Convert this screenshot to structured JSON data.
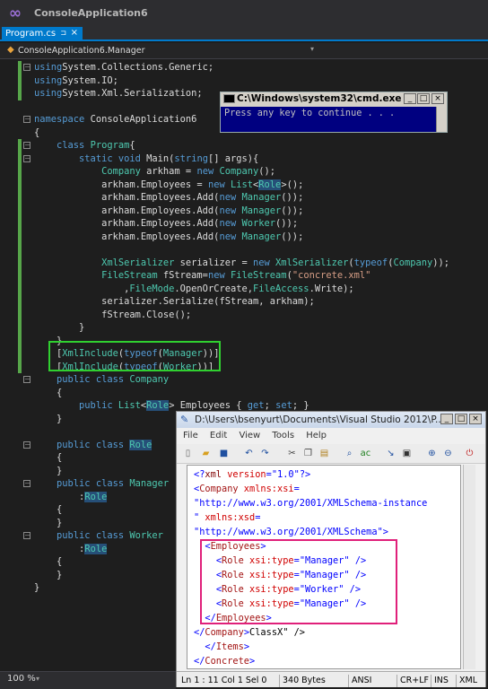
{
  "app": {
    "title": "ConsoleApplication6"
  },
  "tab": {
    "label": "Program.cs",
    "pin": "⊐",
    "close": "×"
  },
  "nav": {
    "label": "ConsoleApplication6.Manager",
    "dropdown": "▾"
  },
  "code": [
    {
      "t": [
        [
          "kw",
          "using"
        ],
        [
          "",
          "System.Collections.Generic;"
        ]
      ]
    },
    {
      "t": [
        [
          "kw",
          "using"
        ],
        [
          "",
          "System.IO;"
        ]
      ]
    },
    {
      "t": [
        [
          "kw",
          "using"
        ],
        [
          "",
          "System.Xml.Serialization;"
        ]
      ]
    },
    {
      "t": []
    },
    {
      "t": [
        [
          "kw",
          "namespace"
        ],
        [
          "",
          " ConsoleApplication6"
        ]
      ]
    },
    {
      "t": [
        [
          "",
          "{"
        ]
      ]
    },
    {
      "t": [
        [
          "",
          "    "
        ],
        [
          "kw",
          "class"
        ],
        [
          "",
          " "
        ],
        [
          "ty",
          "Program"
        ],
        [
          "",
          "{"
        ]
      ]
    },
    {
      "t": [
        [
          "",
          "        "
        ],
        [
          "kw",
          "static void"
        ],
        [
          "",
          " Main("
        ],
        [
          "kw",
          "string"
        ],
        [
          "",
          "[] args){"
        ]
      ]
    },
    {
      "t": [
        [
          "",
          "            "
        ],
        [
          "ty",
          "Company"
        ],
        [
          "",
          " arkham = "
        ],
        [
          "kw",
          "new"
        ],
        [
          "",
          " "
        ],
        [
          "ty",
          "Company"
        ],
        [
          "",
          "();"
        ]
      ]
    },
    {
      "t": [
        [
          "",
          "            arkham.Employees = "
        ],
        [
          "kw",
          "new"
        ],
        [
          "",
          " "
        ],
        [
          "ty",
          "List"
        ],
        [
          "",
          "<"
        ],
        [
          "hl ty",
          "Role"
        ],
        [
          "",
          ">();"
        ]
      ]
    },
    {
      "t": [
        [
          "",
          "            arkham.Employees.Add("
        ],
        [
          "kw",
          "new"
        ],
        [
          "",
          " "
        ],
        [
          "ty",
          "Manager"
        ],
        [
          "",
          "());"
        ]
      ]
    },
    {
      "t": [
        [
          "",
          "            arkham.Employees.Add("
        ],
        [
          "kw",
          "new"
        ],
        [
          "",
          " "
        ],
        [
          "ty",
          "Manager"
        ],
        [
          "",
          "());"
        ]
      ]
    },
    {
      "t": [
        [
          "",
          "            arkham.Employees.Add("
        ],
        [
          "kw",
          "new"
        ],
        [
          "",
          " "
        ],
        [
          "ty",
          "Worker"
        ],
        [
          "",
          "());"
        ]
      ]
    },
    {
      "t": [
        [
          "",
          "            arkham.Employees.Add("
        ],
        [
          "kw",
          "new"
        ],
        [
          "",
          " "
        ],
        [
          "ty",
          "Manager"
        ],
        [
          "",
          "());"
        ]
      ]
    },
    {
      "t": []
    },
    {
      "t": [
        [
          "",
          "            "
        ],
        [
          "ty",
          "XmlSerializer"
        ],
        [
          "",
          " serializer = "
        ],
        [
          "kw",
          "new"
        ],
        [
          "",
          " "
        ],
        [
          "ty",
          "XmlSerializer"
        ],
        [
          "",
          "("
        ],
        [
          "kw",
          "typeof"
        ],
        [
          "",
          "("
        ],
        [
          "ty",
          "Company"
        ],
        [
          "",
          "));"
        ]
      ]
    },
    {
      "t": [
        [
          "",
          "            "
        ],
        [
          "ty",
          "FileStream"
        ],
        [
          "",
          " fStream="
        ],
        [
          "kw",
          "new"
        ],
        [
          "",
          " "
        ],
        [
          "ty",
          "FileStream"
        ],
        [
          "",
          "("
        ],
        [
          "st",
          "\"concrete.xml\""
        ]
      ]
    },
    {
      "t": [
        [
          "",
          "                ,"
        ],
        [
          "ty",
          "FileMode"
        ],
        [
          "",
          ".OpenOrCreate,"
        ],
        [
          "ty",
          "FileAccess"
        ],
        [
          "",
          ".Write);"
        ]
      ]
    },
    {
      "t": [
        [
          "",
          "            serializer.Serialize(fStream, arkham);"
        ]
      ]
    },
    {
      "t": [
        [
          "",
          "            fStream.Close();"
        ]
      ]
    },
    {
      "t": [
        [
          "",
          "        }"
        ]
      ]
    },
    {
      "t": [
        [
          "",
          "    }"
        ]
      ]
    },
    {
      "t": [
        [
          "",
          "    ["
        ],
        [
          "ty",
          "XmlInclude"
        ],
        [
          "",
          "("
        ],
        [
          "kw",
          "typeof"
        ],
        [
          "",
          "("
        ],
        [
          "ty",
          "Manager"
        ],
        [
          "",
          "))]"
        ]
      ]
    },
    {
      "t": [
        [
          "",
          "    ["
        ],
        [
          "ty",
          "XmlInclude"
        ],
        [
          "",
          "("
        ],
        [
          "kw",
          "typeof"
        ],
        [
          "",
          "("
        ],
        [
          "ty",
          "Worker"
        ],
        [
          "",
          "))]"
        ]
      ]
    },
    {
      "t": [
        [
          "",
          "    "
        ],
        [
          "kw",
          "public class"
        ],
        [
          "",
          " "
        ],
        [
          "ty",
          "Company"
        ]
      ]
    },
    {
      "t": [
        [
          "",
          "    {"
        ]
      ]
    },
    {
      "t": [
        [
          "",
          "        "
        ],
        [
          "kw",
          "public"
        ],
        [
          "",
          " "
        ],
        [
          "ty",
          "List"
        ],
        [
          "",
          "<"
        ],
        [
          "hl ty",
          "Role"
        ],
        [
          "",
          "> Employees { "
        ],
        [
          "kw",
          "get"
        ],
        [
          "",
          "; "
        ],
        [
          "kw",
          "set"
        ],
        [
          "",
          "; }"
        ]
      ]
    },
    {
      "t": [
        [
          "",
          "    }"
        ]
      ]
    },
    {
      "t": []
    },
    {
      "t": [
        [
          "",
          "    "
        ],
        [
          "kw",
          "public class"
        ],
        [
          "",
          " "
        ],
        [
          "hl ty",
          "Role"
        ]
      ]
    },
    {
      "t": [
        [
          "",
          "    {"
        ]
      ]
    },
    {
      "t": [
        [
          "",
          "    }"
        ]
      ]
    },
    {
      "t": [
        [
          "",
          "    "
        ],
        [
          "kw",
          "public class"
        ],
        [
          "",
          " "
        ],
        [
          "ty",
          "Manager"
        ]
      ]
    },
    {
      "t": [
        [
          "",
          "        :"
        ],
        [
          "hl ty",
          "Role"
        ]
      ]
    },
    {
      "t": [
        [
          "",
          "    {"
        ]
      ]
    },
    {
      "t": [
        [
          "",
          "    }"
        ]
      ]
    },
    {
      "t": [
        [
          "",
          "    "
        ],
        [
          "kw",
          "public class"
        ],
        [
          "",
          " "
        ],
        [
          "ty",
          "Worker"
        ]
      ]
    },
    {
      "t": [
        [
          "",
          "        :"
        ],
        [
          "hl ty",
          "Role"
        ]
      ]
    },
    {
      "t": [
        [
          "",
          "    {"
        ]
      ]
    },
    {
      "t": [
        [
          "",
          "    }"
        ]
      ]
    },
    {
      "t": [
        [
          "",
          "}"
        ]
      ]
    }
  ],
  "cmd": {
    "title": "C:\\Windows\\system32\\cmd.exe",
    "output": "Press any key to continue . . .",
    "min": "_",
    "max": "□",
    "close": "×"
  },
  "notepad": {
    "title": "D:\\Users\\bsenyurt\\Documents\\Visual Studio 2012\\P...",
    "menu": [
      "File",
      "Edit",
      "View",
      "Tools",
      "Help"
    ],
    "xml": [
      [
        [
          "xb",
          "<?"
        ],
        [
          "xk",
          "xml"
        ],
        [
          "xa",
          " version"
        ],
        [
          "xb",
          "="
        ],
        [
          "xv",
          "\"1.0\""
        ],
        [
          "xb",
          "?>"
        ]
      ],
      [
        [
          "xb",
          "<"
        ],
        [
          "xt",
          "Company"
        ],
        [
          "xa",
          " xmlns:xsi"
        ],
        [
          "xb",
          "="
        ]
      ],
      [
        [
          "xv",
          "\"http://www.w3.org/2001/XMLSchema-instance"
        ]
      ],
      [
        [
          "xv",
          "\""
        ],
        [
          "xa",
          " xmlns:xsd"
        ],
        [
          "xb",
          "="
        ]
      ],
      [
        [
          "xv",
          "\"http://www.w3.org/2001/XMLSchema\""
        ],
        [
          "xb",
          ">"
        ]
      ],
      [
        [
          "",
          "  "
        ],
        [
          "xb",
          "<"
        ],
        [
          "xt",
          "Employees"
        ],
        [
          "xb",
          ">"
        ]
      ],
      [
        [
          "",
          "    "
        ],
        [
          "xb",
          "<"
        ],
        [
          "xt",
          "Role"
        ],
        [
          "xa",
          " xsi:type"
        ],
        [
          "xb",
          "="
        ],
        [
          "xv",
          "\"Manager\""
        ],
        [
          "xb",
          " />"
        ]
      ],
      [
        [
          "",
          "    "
        ],
        [
          "xb",
          "<"
        ],
        [
          "xt",
          "Role"
        ],
        [
          "xa",
          " xsi:type"
        ],
        [
          "xb",
          "="
        ],
        [
          "xv",
          "\"Manager\""
        ],
        [
          "xb",
          " />"
        ]
      ],
      [
        [
          "",
          "    "
        ],
        [
          "xb",
          "<"
        ],
        [
          "xt",
          "Role"
        ],
        [
          "xa",
          " xsi:type"
        ],
        [
          "xb",
          "="
        ],
        [
          "xv",
          "\"Worker\""
        ],
        [
          "xb",
          " />"
        ]
      ],
      [
        [
          "",
          "    "
        ],
        [
          "xb",
          "<"
        ],
        [
          "xt",
          "Role"
        ],
        [
          "xa",
          " xsi:type"
        ],
        [
          "xb",
          "="
        ],
        [
          "xv",
          "\"Manager\""
        ],
        [
          "xb",
          " />"
        ]
      ],
      [
        [
          "",
          "  "
        ],
        [
          "xb",
          "</"
        ],
        [
          "xt",
          "Employees"
        ],
        [
          "xb",
          ">"
        ]
      ],
      [
        [
          "xb",
          "</"
        ],
        [
          "xt",
          "Company"
        ],
        [
          "xb",
          ">"
        ],
        [
          "",
          "ClassX\" />"
        ]
      ],
      [
        [
          "",
          "  "
        ],
        [
          "xb",
          "</"
        ],
        [
          "xt",
          "Items"
        ],
        [
          "xb",
          ">"
        ]
      ],
      [
        [
          "xb",
          "</"
        ],
        [
          "xt",
          "Concrete"
        ],
        [
          "xb",
          ">"
        ]
      ]
    ],
    "status": {
      "pos": "Ln 1 : 11  Col 1  Sel 0",
      "size": "340 Bytes",
      "enc": "ANSI",
      "eol": "CR+LF",
      "mode": "INS",
      "lang": "XML"
    }
  },
  "vs_status": {
    "zoom": "100 %",
    "dropdown": "▾"
  }
}
